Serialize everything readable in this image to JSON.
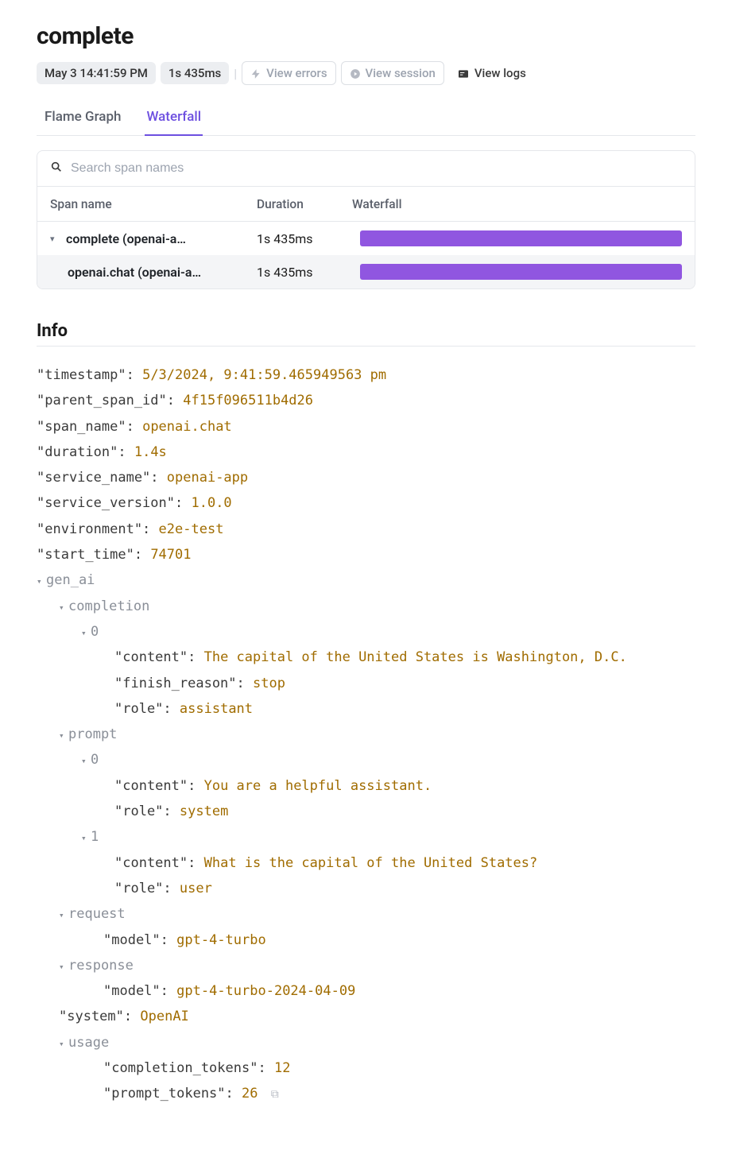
{
  "header": {
    "title": "complete",
    "timestamp_pill": "May 3 14:41:59 PM",
    "duration_pill": "1s 435ms",
    "view_errors": "View errors",
    "view_session": "View session",
    "view_logs": "View logs"
  },
  "tabs": {
    "flame": "Flame Graph",
    "waterfall": "Waterfall"
  },
  "search": {
    "placeholder": "Search span names"
  },
  "table": {
    "col_span": "Span name",
    "col_duration": "Duration",
    "col_waterfall": "Waterfall",
    "rows": [
      {
        "name": "complete (openai-a…",
        "duration": "1s 435ms"
      },
      {
        "name": "openai.chat (openai-a…",
        "duration": "1s 435ms"
      }
    ]
  },
  "info": {
    "title": "Info",
    "timestamp_k": "\"timestamp\":",
    "timestamp_v": "5/3/2024, 9:41:59.465949563 pm",
    "parent_span_id_k": "\"parent_span_id\":",
    "parent_span_id_v": "4f15f096511b4d26",
    "span_name_k": "\"span_name\":",
    "span_name_v": "openai.chat",
    "duration_k": "\"duration\":",
    "duration_v": "1.4s",
    "service_name_k": "\"service_name\":",
    "service_name_v": "openai-app",
    "service_version_k": "\"service_version\":",
    "service_version_v": "1.0.0",
    "environment_k": "\"environment\":",
    "environment_v": "e2e-test",
    "start_time_k": "\"start_time\":",
    "start_time_v": "74701",
    "tree": {
      "gen_ai": "gen_ai",
      "completion": "completion",
      "zero": "0",
      "one": "1",
      "content_k": "\"content\":",
      "finish_reason_k": "\"finish_reason\":",
      "role_k": "\"role\":",
      "completion0_content": "The capital of the United States is Washington, D.C.",
      "completion0_finish": "stop",
      "completion0_role": "assistant",
      "prompt": "prompt",
      "prompt0_content": "You are a helpful assistant.",
      "prompt0_role": "system",
      "prompt1_content": "What is the capital of the United States?",
      "prompt1_role": "user",
      "request": "request",
      "model_k": "\"model\":",
      "request_model": "gpt-4-turbo",
      "response": "response",
      "response_model": "gpt-4-turbo-2024-04-09",
      "system_k": "\"system\":",
      "system_v": "OpenAI",
      "usage": "usage",
      "completion_tokens_k": "\"completion_tokens\":",
      "completion_tokens_v": "12",
      "prompt_tokens_k": "\"prompt_tokens\":",
      "prompt_tokens_v": "26"
    }
  }
}
